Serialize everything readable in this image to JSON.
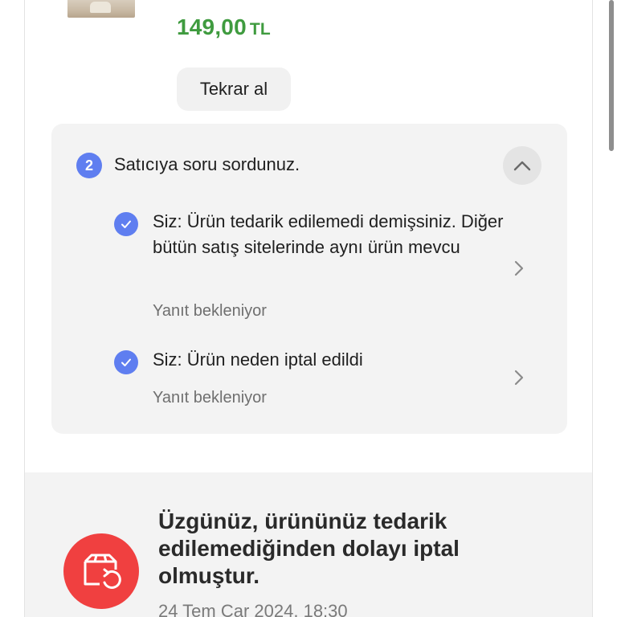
{
  "product": {
    "price_value": "149,00",
    "price_currency": "TL",
    "reorder_label": "Tekrar al"
  },
  "questions": {
    "count": "2",
    "title": "Satıcıya soru sordunuz.",
    "items": [
      {
        "question": "Siz: Ürün tedarik edilemedi demişsiniz. Diğer bütün satış sitelerinde aynı ürün mevcu",
        "status": "Yanıt bekleniyor"
      },
      {
        "question": "Siz: Ürün neden iptal edildi",
        "status": "Yanıt bekleniyor"
      }
    ]
  },
  "cancellation": {
    "message": "Üzgünüz, ürününüz tedarik edilemediğinden dolayı iptal olmuştur.",
    "date": "24 Tem Çar 2024, 18:30"
  },
  "icons": {
    "collapse": "chevron-up-icon",
    "check": "check-circle-icon",
    "item_arrow": "chevron-right-icon",
    "cancel": "package-refresh-icon"
  },
  "colors": {
    "price": "#3f9b3f",
    "accent": "#5f7ef0",
    "cancel": "#f04040"
  }
}
